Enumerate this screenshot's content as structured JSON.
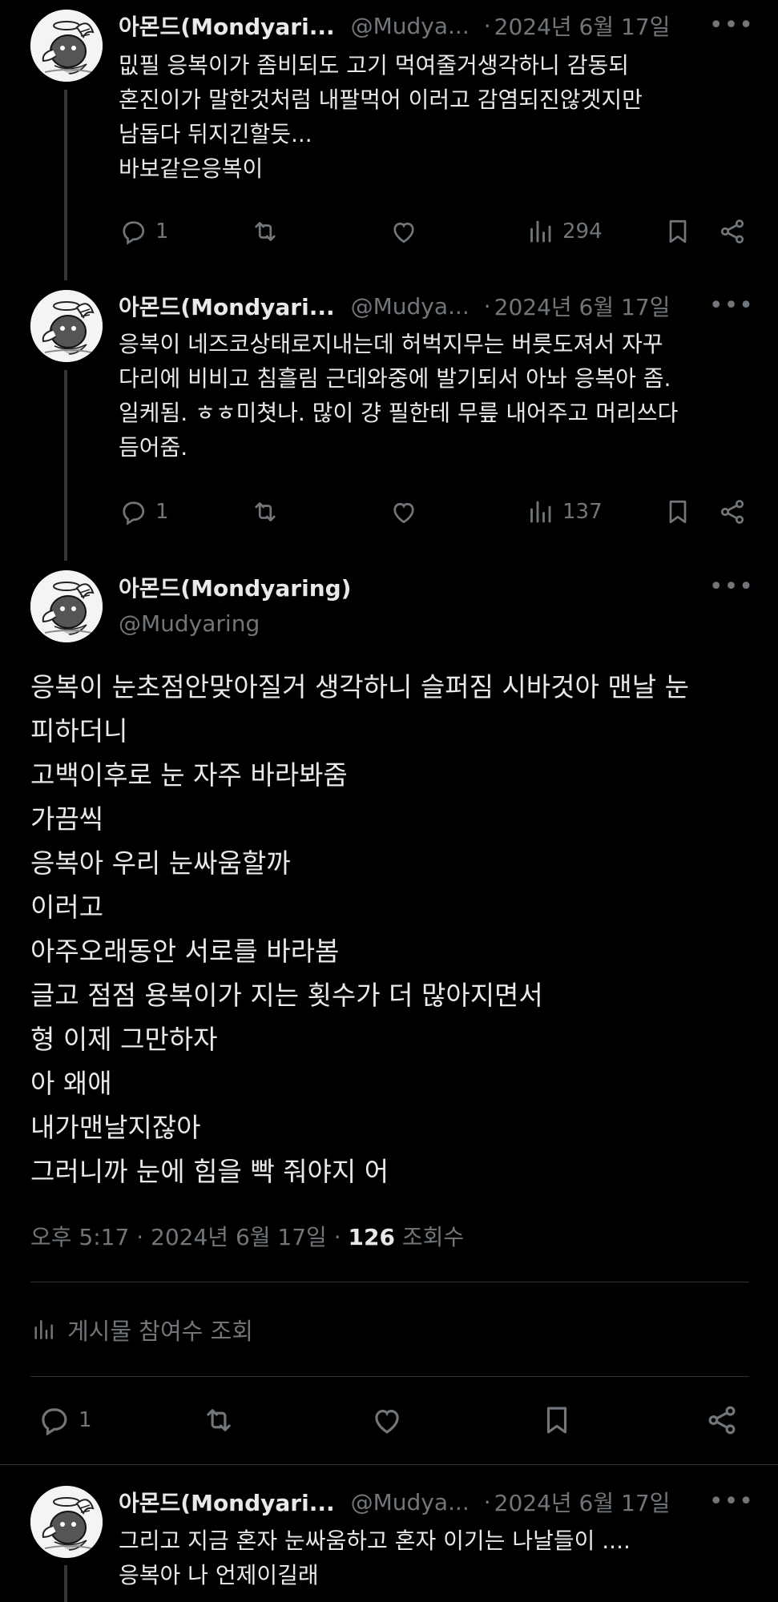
{
  "posts": [
    {
      "author": "아몬드(Mondyari...",
      "handle": "@Mudya...",
      "sep": "·",
      "date": "2024년 6월 17일",
      "more": "•••",
      "text": "밊필 응복이가 좀비되도 고기 먹여줄거생각하니 감동되\n혼진이가 말한것처럼 내팔먹어 이러고 감염되진않겟지만\n남돕다 뒤지긴할듯...\n바보같은응복이",
      "replies": "1",
      "views": "294"
    },
    {
      "author": "아몬드(Mondyari...",
      "handle": "@Mudya...",
      "sep": "·",
      "date": "2024년 6월 17일",
      "more": "•••",
      "text": "응복이 네즈코상태로지내는데 허벅지무는 버릇도져서 자꾸\n다리에 비비고 침흘림 근데와중에 발기되서 아놔 응복아 좀.\n일케됨. ㅎㅎ미쳣나. 많이 걍 필한테 무릎 내어주고 머리쓰다\n듬어줌.",
      "replies": "1",
      "views": "137"
    }
  ],
  "main": {
    "author": "아몬드(Mondyaring)",
    "handle": "@Mudyaring",
    "more": "•••",
    "text": "응복이 눈초점안맞아질거 생각하니 슬퍼짐 시바것아 맨날 눈\n피하더니\n고백이후로 눈 자주 바라봐줌\n가끔씩\n 응복아 우리 눈싸움할까\n이러고\n아주오래동안 서로를 바라봄\n글고 점점 용복이가 지는 횟수가 더 많아지면서\n형 이제 그만하자\n아 왜애\n내가맨날지잖아\n그러니까 눈에 힘을 빡 줘야지 어",
    "time": "오후 5:17",
    "sep": "·",
    "date": "2024년 6월 17일",
    "views_count": "126",
    "views_label": "조회수",
    "engagement_label": "게시물 참여수 조회",
    "replies": "1"
  },
  "reply": {
    "author": "아몬드(Mondyari...",
    "handle": "@Mudya...",
    "sep": "·",
    "date": "2024년 6월 17일",
    "more": "•••",
    "text": "그리고 지금 혼자 눈싸움하고 혼자 이기는 나날들이 ....\n응복아 나 언제이길래"
  },
  "icons": {
    "reply": "reply-icon",
    "repost": "repost-icon",
    "like": "like-icon",
    "views": "views-icon",
    "bookmark": "bookmark-icon",
    "share": "share-icon"
  },
  "colors": {
    "background": "#000000",
    "text": "#e7e9ea",
    "muted": "#71767b",
    "divider": "#2f3336"
  }
}
